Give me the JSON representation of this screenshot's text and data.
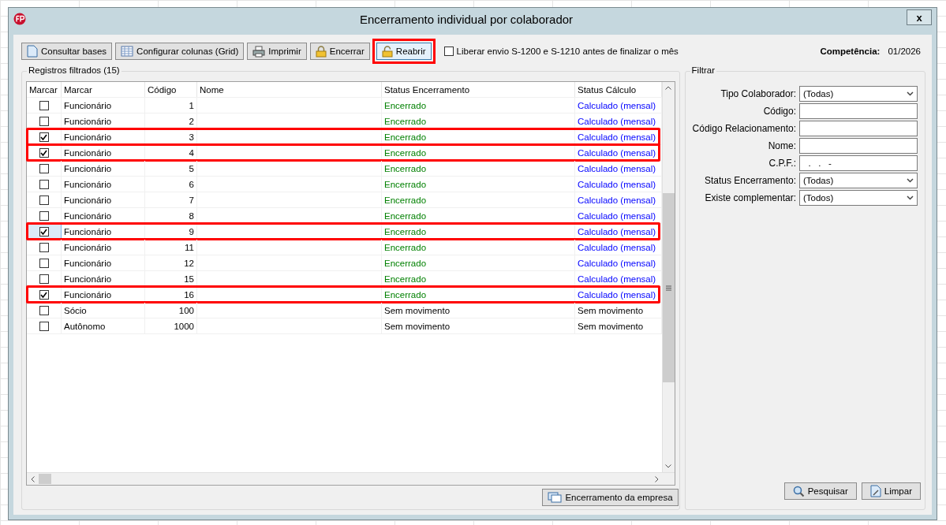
{
  "window": {
    "title": "Encerramento individual por colaborador",
    "close": "x"
  },
  "toolbar": {
    "buttons": [
      {
        "label": "Consultar bases",
        "highlighted": false
      },
      {
        "label": "Configurar colunas (Grid)",
        "highlighted": false
      },
      {
        "label": "Imprimir",
        "highlighted": false
      },
      {
        "label": "Encerrar",
        "highlighted": false
      },
      {
        "label": "Reabrir",
        "highlighted": true
      }
    ],
    "option": {
      "label": "Liberar envio S-1200 e S-1210 antes de finalizar o mês",
      "checked": false
    },
    "competencia": {
      "label": "Competência:",
      "value": "01/2026"
    }
  },
  "records": {
    "title": "Registros filtrados (15)",
    "columns": [
      "Marcar",
      "Marcar",
      "Código",
      "Nome",
      "Status Encerramento",
      "Status Cálculo"
    ],
    "rows": [
      {
        "checked": false,
        "selected": false,
        "highlighted": false,
        "type": "Funcionário",
        "code": "1",
        "status": {
          "text": "Encerrado",
          "kind": "closed"
        },
        "calc": {
          "text": "Calculado (mensal)",
          "kind": "calculated"
        }
      },
      {
        "checked": false,
        "selected": false,
        "highlighted": false,
        "type": "Funcionário",
        "code": "2",
        "status": {
          "text": "Encerrado",
          "kind": "closed"
        },
        "calc": {
          "text": "Calculado (mensal)",
          "kind": "calculated"
        }
      },
      {
        "checked": true,
        "selected": false,
        "highlighted": true,
        "type": "Funcionário",
        "code": "3",
        "status": {
          "text": "Encerrado",
          "kind": "closed"
        },
        "calc": {
          "text": "Calculado (mensal)",
          "kind": "calculated"
        }
      },
      {
        "checked": true,
        "selected": false,
        "highlighted": true,
        "type": "Funcionário",
        "code": "4",
        "status": {
          "text": "Encerrado",
          "kind": "closed"
        },
        "calc": {
          "text": "Calculado (mensal)",
          "kind": "calculated"
        }
      },
      {
        "checked": false,
        "selected": false,
        "highlighted": false,
        "type": "Funcionário",
        "code": "5",
        "status": {
          "text": "Encerrado",
          "kind": "closed"
        },
        "calc": {
          "text": "Calculado (mensal)",
          "kind": "calculated"
        }
      },
      {
        "checked": false,
        "selected": false,
        "highlighted": false,
        "type": "Funcionário",
        "code": "6",
        "status": {
          "text": "Encerrado",
          "kind": "closed"
        },
        "calc": {
          "text": "Calculado (mensal)",
          "kind": "calculated"
        }
      },
      {
        "checked": false,
        "selected": false,
        "highlighted": false,
        "type": "Funcionário",
        "code": "7",
        "status": {
          "text": "Encerrado",
          "kind": "closed"
        },
        "calc": {
          "text": "Calculado (mensal)",
          "kind": "calculated"
        }
      },
      {
        "checked": false,
        "selected": false,
        "highlighted": false,
        "type": "Funcionário",
        "code": "8",
        "status": {
          "text": "Encerrado",
          "kind": "closed"
        },
        "calc": {
          "text": "Calculado (mensal)",
          "kind": "calculated"
        }
      },
      {
        "checked": true,
        "selected": true,
        "highlighted": true,
        "type": "Funcionário",
        "code": "9",
        "status": {
          "text": "Encerrado",
          "kind": "closed"
        },
        "calc": {
          "text": "Calculado (mensal)",
          "kind": "calculated"
        }
      },
      {
        "checked": false,
        "selected": false,
        "highlighted": false,
        "type": "Funcionário",
        "code": "11",
        "status": {
          "text": "Encerrado",
          "kind": "closed"
        },
        "calc": {
          "text": "Calculado (mensal)",
          "kind": "calculated"
        }
      },
      {
        "checked": false,
        "selected": false,
        "highlighted": false,
        "type": "Funcionário",
        "code": "12",
        "status": {
          "text": "Encerrado",
          "kind": "closed"
        },
        "calc": {
          "text": "Calculado (mensal)",
          "kind": "calculated"
        }
      },
      {
        "checked": false,
        "selected": false,
        "highlighted": false,
        "type": "Funcionário",
        "code": "15",
        "status": {
          "text": "Encerrado",
          "kind": "closed"
        },
        "calc": {
          "text": "Calculado (mensal)",
          "kind": "calculated"
        }
      },
      {
        "checked": true,
        "selected": false,
        "highlighted": true,
        "type": "Funcionário",
        "code": "16",
        "status": {
          "text": "Encerrado",
          "kind": "closed"
        },
        "calc": {
          "text": "Calculado (mensal)",
          "kind": "calculated"
        }
      },
      {
        "checked": false,
        "selected": false,
        "highlighted": false,
        "type": "Sócio",
        "code": "100",
        "status": {
          "text": "Sem movimento",
          "kind": "none"
        },
        "calc": {
          "text": "Sem movimento",
          "kind": "none"
        }
      },
      {
        "checked": false,
        "selected": false,
        "highlighted": false,
        "type": "Autônomo",
        "code": "1000",
        "status": {
          "text": "Sem movimento",
          "kind": "none"
        },
        "calc": {
          "text": "Sem movimento",
          "kind": "none"
        }
      }
    ],
    "footer_button": {
      "label": "Encerramento da empresa"
    }
  },
  "filter": {
    "title": "Filtrar",
    "fields": [
      {
        "label": "Tipo Colaborador:",
        "kind": "select",
        "value": "(Todas)"
      },
      {
        "label": "Código:",
        "kind": "text"
      },
      {
        "label": "Código Relacionamento:",
        "kind": "text"
      },
      {
        "label": "Nome:",
        "kind": "text"
      },
      {
        "label": "C.P.F.:",
        "kind": "text",
        "value": "  .   .   -"
      },
      {
        "label": "Status Encerramento:",
        "kind": "select",
        "value": "(Todas)"
      },
      {
        "label": "Existe complementar:",
        "kind": "select",
        "value": "(Todos)"
      }
    ],
    "buttons": [
      {
        "label": "Pesquisar"
      },
      {
        "label": "Limpar"
      }
    ]
  }
}
